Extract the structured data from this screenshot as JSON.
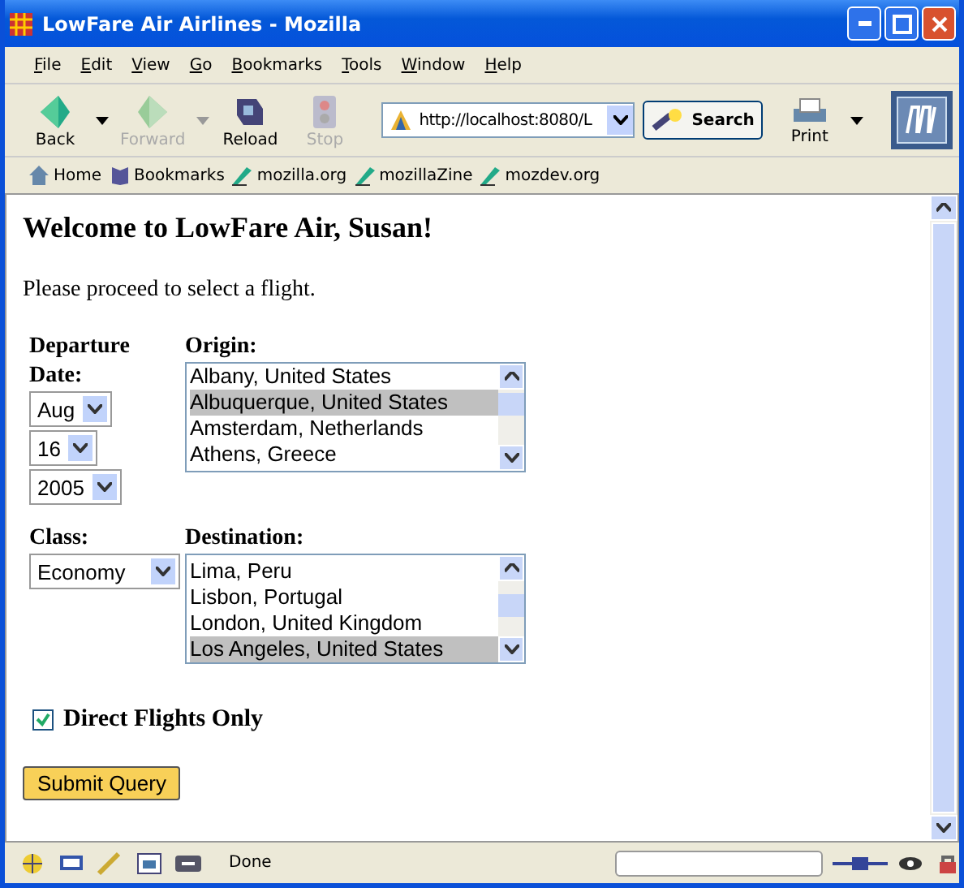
{
  "window": {
    "title": "LowFare Air Airlines - Mozilla"
  },
  "menu": [
    "File",
    "Edit",
    "View",
    "Go",
    "Bookmarks",
    "Tools",
    "Window",
    "Help"
  ],
  "toolbar": {
    "buttons": [
      {
        "label": "Back",
        "disabled": false,
        "dropdown": true
      },
      {
        "label": "Forward",
        "disabled": true,
        "dropdown": true
      },
      {
        "label": "Reload",
        "disabled": false,
        "dropdown": false
      },
      {
        "label": "Stop",
        "disabled": true,
        "dropdown": false
      }
    ],
    "url": "http://localhost:8080/L",
    "search": "Search",
    "print": "Print"
  },
  "bookmarks": [
    "Home",
    "Bookmarks",
    "mozilla.org",
    "mozillaZine",
    "mozdev.org"
  ],
  "page": {
    "heading": "Welcome to LowFare Air, Susan!",
    "intro": "Please proceed to select a flight.",
    "date_label": "Departure Date:",
    "month": "Aug",
    "day": "16",
    "year": "2005",
    "origin_label": "Origin:",
    "origins": [
      {
        "label": "Albany, United States",
        "selected": false
      },
      {
        "label": "Albuquerque, United States",
        "selected": true
      },
      {
        "label": "Amsterdam, Netherlands",
        "selected": false
      },
      {
        "label": "Athens, Greece",
        "selected": false
      }
    ],
    "class_label": "Class:",
    "class": "Economy",
    "destination_label": "Destination:",
    "destinations": [
      {
        "label": "Lima, Peru",
        "selected": false
      },
      {
        "label": "Lisbon, Portugal",
        "selected": false
      },
      {
        "label": "London, United Kingdom",
        "selected": false
      },
      {
        "label": "Los Angeles, United States",
        "selected": true
      }
    ],
    "direct": {
      "label": "Direct Flights Only",
      "checked": true
    },
    "submit": "Submit Query"
  },
  "status_bar": {
    "text": "Done"
  }
}
